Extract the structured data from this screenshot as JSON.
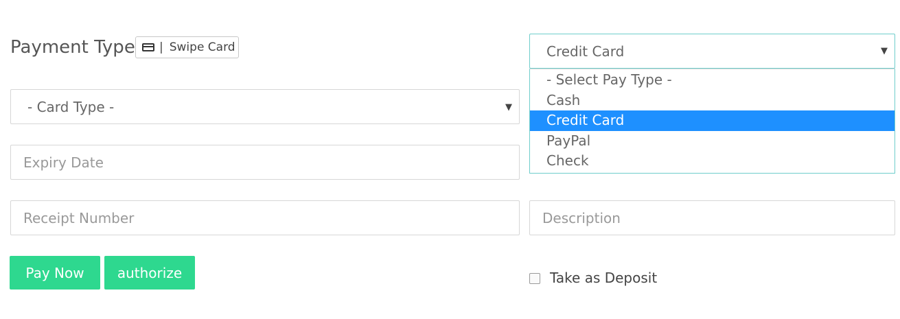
{
  "payment": {
    "title": "Payment Type",
    "swipe_card_label": "Swipe Card",
    "swipe_separator": "|"
  },
  "card_type": {
    "selected": "- Card Type -"
  },
  "pay_type": {
    "selected": "Credit Card",
    "options": [
      "- Select Pay Type -",
      "Cash",
      "Credit Card",
      "PayPal",
      "Check"
    ],
    "highlighted_option": "Credit Card"
  },
  "fields": {
    "expiry_placeholder": "Expiry Date",
    "receipt_placeholder": "Receipt Number",
    "description_placeholder": "Description"
  },
  "actions": {
    "pay_now": "Pay Now",
    "authorize": "authorize"
  },
  "deposit": {
    "label": "Take as Deposit",
    "checked": false
  },
  "icons": {
    "card": "credit-card-icon",
    "caret": "caret-down-icon"
  },
  "colors": {
    "accent_button": "#2ed88f",
    "highlight": "#1e90ff",
    "focus_border": "#6ecdcb"
  }
}
